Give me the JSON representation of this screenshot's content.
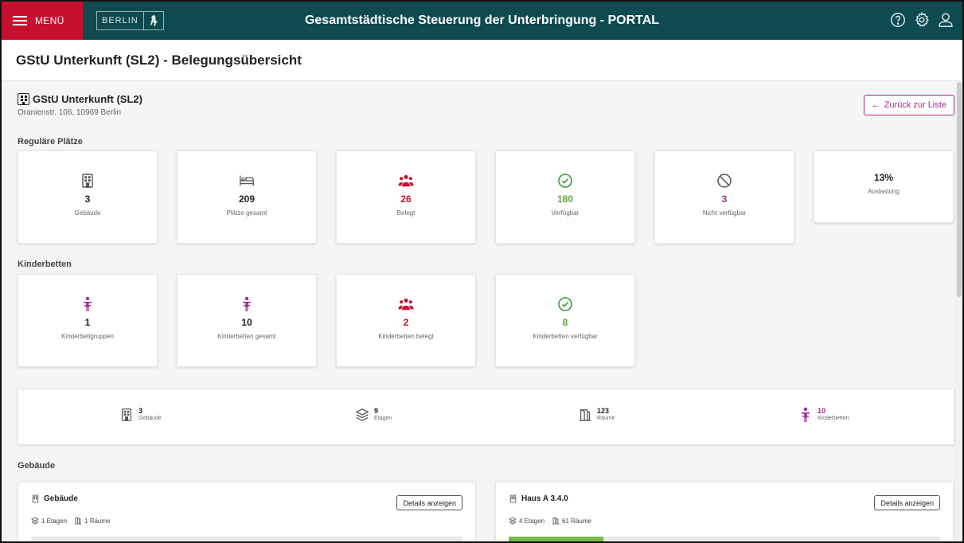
{
  "topbar": {
    "menu_label": "MENÜ",
    "logo_text": "BERLIN",
    "title": "Gesamtstädtische Steuerung der Unterbringung - PORTAL"
  },
  "page": {
    "title": "GStU Unterkunft (SL2) - Belegungsübersicht"
  },
  "facility": {
    "name": "GStU Unterkunft (SL2)",
    "address": "Oranienstr. 106, 10969 Berlin",
    "back_label": "Zurück zur Liste"
  },
  "regular": {
    "label": "Reguläre Plätze",
    "cards": [
      {
        "value": "3",
        "label": "Gebäude",
        "icon": "building-icon"
      },
      {
        "value": "209",
        "label": "Plätze gesamt",
        "icon": "bed-icon"
      },
      {
        "value": "26",
        "label": "Belegt",
        "icon": "people-icon"
      },
      {
        "value": "180",
        "label": "Verfügbar",
        "icon": "check-circle-icon"
      },
      {
        "value": "3",
        "label": "Nicht verfügbar",
        "icon": "ban-icon"
      },
      {
        "value": "13%",
        "label": "Auslastung"
      }
    ]
  },
  "children": {
    "label": "Kinderbetten",
    "cards": [
      {
        "value": "1",
        "label": "Kinderbettgruppen",
        "icon": "child-icon"
      },
      {
        "value": "10",
        "label": "Kinderbetten gesamt",
        "icon": "child-icon"
      },
      {
        "value": "2",
        "label": "Kinderbetten belegt",
        "icon": "people-icon"
      },
      {
        "value": "8",
        "label": "Kinderbetten verfügbar",
        "icon": "check-circle-icon"
      }
    ]
  },
  "summary": [
    {
      "value": "3",
      "label": "Gebäude",
      "icon": "building-icon"
    },
    {
      "value": "9",
      "label": "Etagen",
      "icon": "layers-icon"
    },
    {
      "value": "123",
      "label": "Räume",
      "icon": "door-icon"
    },
    {
      "value": "10",
      "label": "Kinderbetten",
      "icon": "child-icon"
    }
  ],
  "buildings": {
    "label": "Gebäude",
    "items": [
      {
        "name": "Gebäude",
        "floors": "1 Etagen",
        "rooms": "1 Räume",
        "details_label": "Details anzeigen",
        "occupancy": 0
      },
      {
        "name": "Haus A 3.4.0",
        "floors": "4 Etagen",
        "rooms": "61 Räume",
        "details_label": "Details anzeigen",
        "occupancy": 0.22
      }
    ]
  },
  "colors": {
    "topbar": "#0e4a4f",
    "menu": "#c8102e",
    "red": "#c8102e",
    "green": "#62a544",
    "purple": "#9b2d8c"
  }
}
